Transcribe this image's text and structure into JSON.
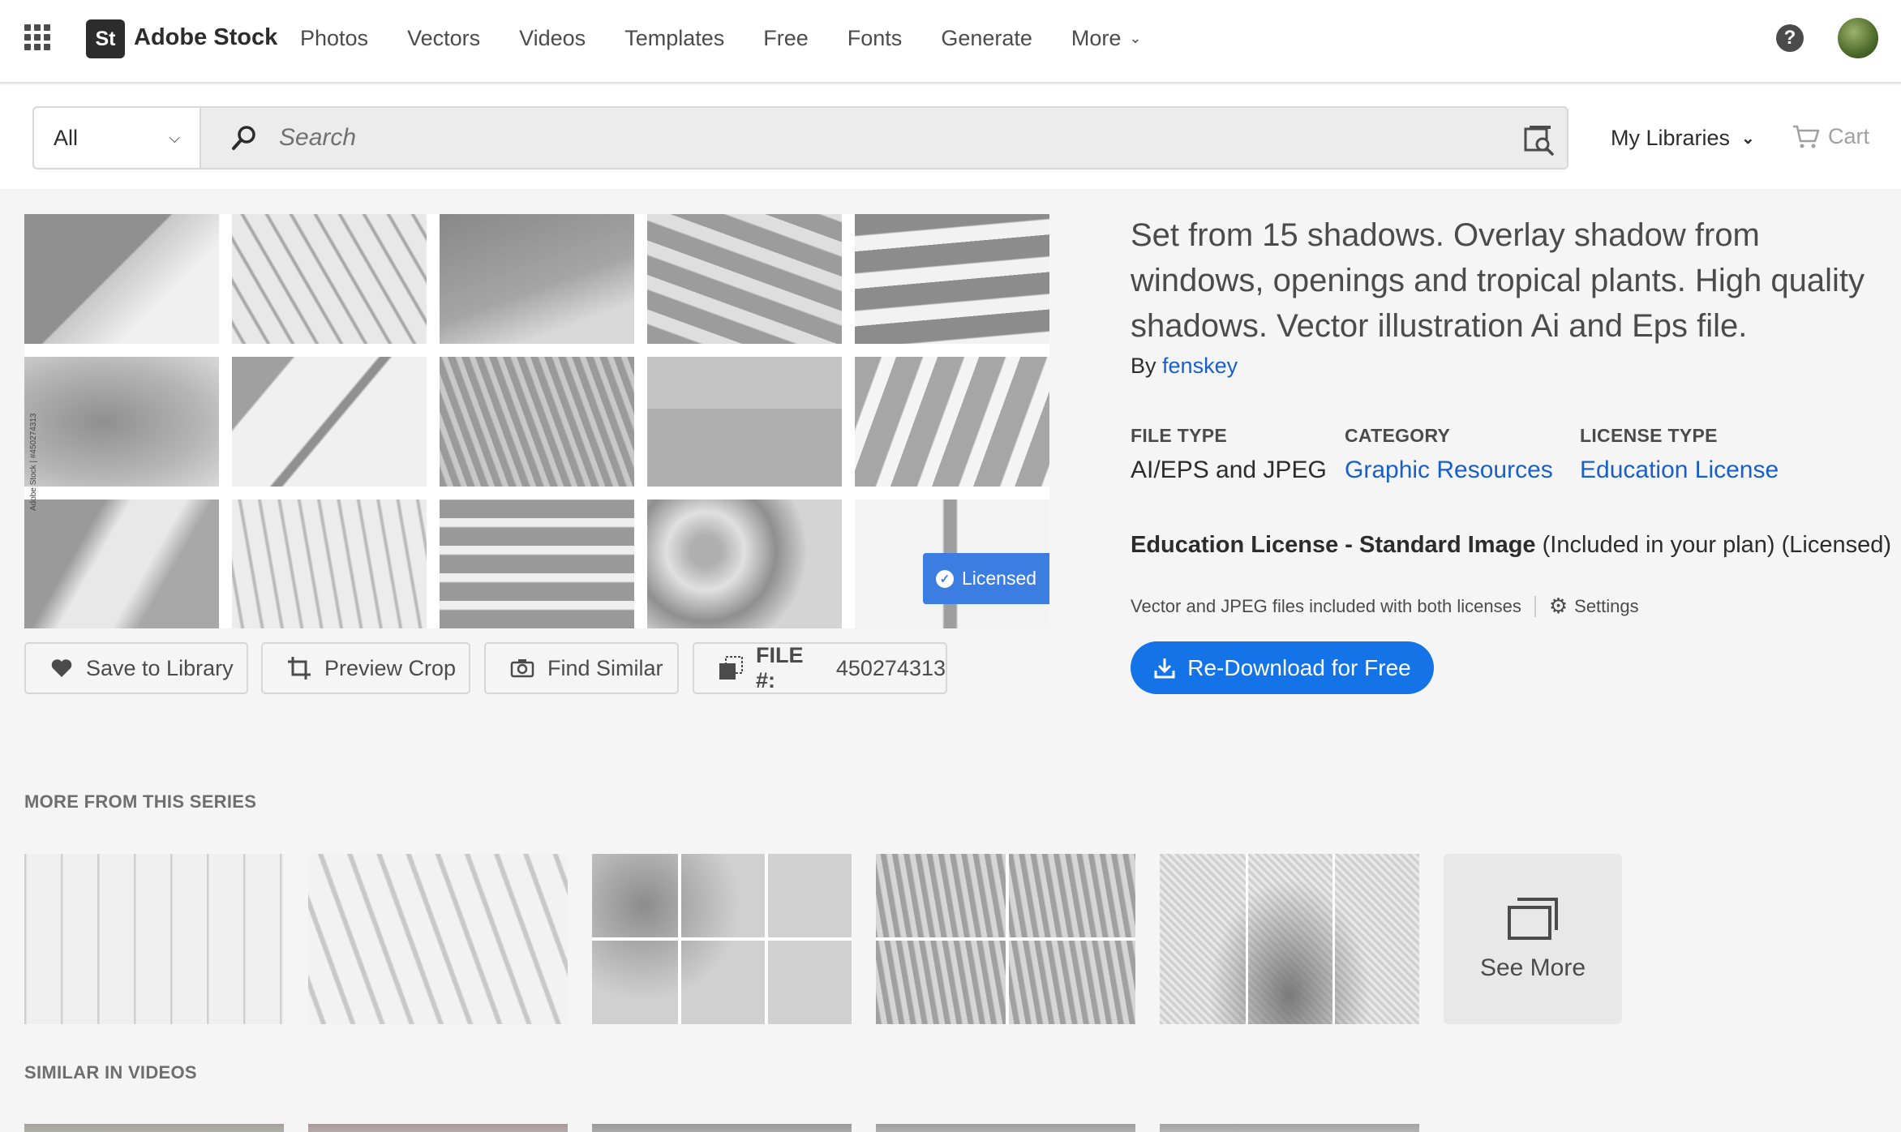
{
  "nav": {
    "logo_mark": "St",
    "logo_text": "Adobe Stock",
    "links": [
      "Photos",
      "Vectors",
      "Videos",
      "Templates",
      "Free",
      "Fonts",
      "Generate",
      "More"
    ],
    "help_glyph": "?"
  },
  "search": {
    "scope": "All",
    "placeholder": "Search",
    "my_libraries": "My Libraries",
    "cart": "Cart"
  },
  "asset": {
    "title": "Set from 15 shadows. Overlay shadow from windows, openings and tropical plants. High quality shadows. Vector illustration Ai and Eps file.",
    "by_label": "By",
    "author": "fenskey",
    "licensed_badge": "Licensed",
    "side_watermark": "Adobe Stock | #450274313",
    "file_type_label": "FILE TYPE",
    "file_type": "AI/EPS and JPEG",
    "category_label": "CATEGORY",
    "category": "Graphic Resources",
    "license_type_label": "LICENSE TYPE",
    "license_type": "Education License",
    "license_name": "Education License - Standard Image",
    "license_note": "(Included in your plan) (Licensed)",
    "files_note": "Vector and JPEG files included with both licenses",
    "settings": "Settings",
    "download": "Re-Download for Free"
  },
  "actions": {
    "save": "Save to Library",
    "crop": "Preview Crop",
    "similar": "Find Similar",
    "file_label": "FILE #:",
    "file_id": "450274313"
  },
  "series": {
    "heading": "MORE FROM THIS SERIES",
    "see_more": "See More"
  },
  "videos": {
    "heading": "SIMILAR IN VIDEOS"
  },
  "colors": {
    "accent": "#1473e6",
    "link": "#1a5fc8",
    "badge": "#3b7de0"
  }
}
